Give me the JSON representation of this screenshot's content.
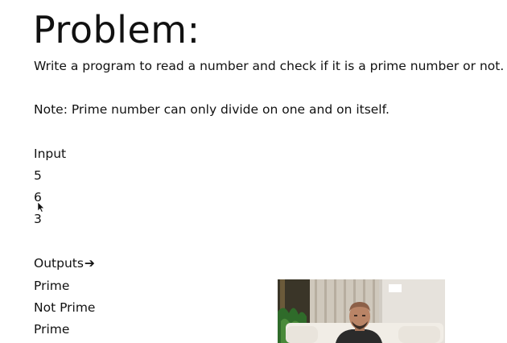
{
  "slide": {
    "title": "Problem:",
    "statement": "Write a program to read a number and check if it is a prime number or not.",
    "note": "Note: Prime number can only divide on one and on itself.",
    "input_label": "Input",
    "inputs": [
      "5",
      "6",
      "3"
    ],
    "output_label": "Outputs",
    "output_arrow": "➔",
    "outputs": [
      "Prime",
      "Not Prime",
      "Prime"
    ]
  },
  "icons": {
    "cursor": "mouse-pointer-icon",
    "arrow": "right-arrow-icon"
  },
  "colors": {
    "text": "#111111",
    "background": "#ffffff"
  }
}
